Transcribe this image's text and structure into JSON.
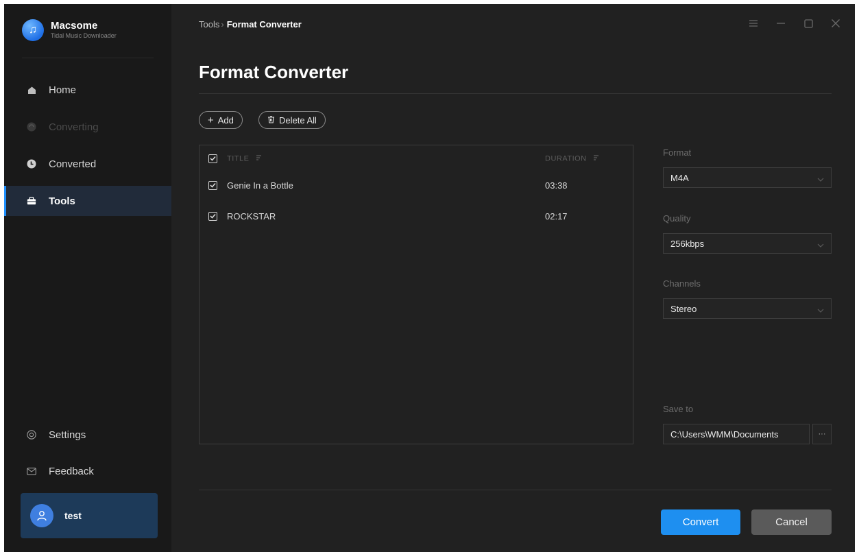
{
  "app": {
    "name": "Macsome",
    "subtitle": "Tidal Music Downloader",
    "logo_glyph": "♫"
  },
  "sidebar": {
    "items": [
      {
        "label": "Home",
        "icon": "home-icon",
        "state": "normal"
      },
      {
        "label": "Converting",
        "icon": "converting-icon",
        "state": "disabled"
      },
      {
        "label": "Converted",
        "icon": "clock-icon",
        "state": "normal"
      },
      {
        "label": "Tools",
        "icon": "toolbox-icon",
        "state": "active"
      }
    ],
    "bottom_items": [
      {
        "label": "Settings",
        "icon": "gear-icon"
      },
      {
        "label": "Feedback",
        "icon": "mail-icon"
      }
    ],
    "user": {
      "name": "test",
      "icon": "user-icon"
    }
  },
  "breadcrumb": {
    "parent": "Tools",
    "separator": "›",
    "current": "Format Converter"
  },
  "window_controls": [
    "menu-icon",
    "minimize-icon",
    "maximize-icon",
    "close-icon"
  ],
  "page": {
    "title": "Format Converter"
  },
  "toolbar": {
    "add_glyph": "+",
    "add_label": "Add",
    "delete_all_label": "Delete All"
  },
  "track_list": {
    "columns": {
      "title": "TITLE",
      "duration": "DURATION"
    },
    "rows": [
      {
        "title": "Genie In a Bottle",
        "duration": "03:38",
        "checked": true
      },
      {
        "title": "ROCKSTAR",
        "duration": "02:17",
        "checked": true
      }
    ]
  },
  "settings": {
    "format": {
      "label": "Format",
      "value": "M4A"
    },
    "quality": {
      "label": "Quality",
      "value": "256kbps"
    },
    "channels": {
      "label": "Channels",
      "value": "Stereo"
    },
    "save_to": {
      "label": "Save to",
      "value": "C:\\Users\\WMM\\Documents",
      "more_glyph": "···"
    }
  },
  "actions": {
    "convert_label": "Convert",
    "cancel_label": "Cancel"
  },
  "colors": {
    "accent": "#1e8ff0",
    "background": "#212121",
    "sidebar": "#191919",
    "active_nav": "#212b3a",
    "user_card": "#1d3a59"
  }
}
